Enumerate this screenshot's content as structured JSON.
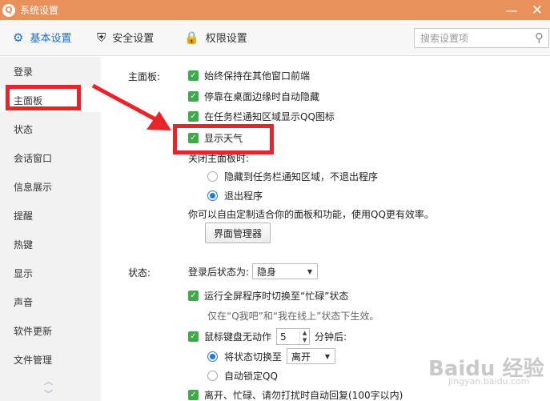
{
  "window": {
    "title": "系统设置",
    "logo_glyph": "Q",
    "minimize_glyph": "—",
    "close_glyph": "✕"
  },
  "tabs": [
    {
      "label": "基本设置",
      "icon": "gear-icon",
      "glyph": "⚙"
    },
    {
      "label": "安全设置",
      "icon": "shield-icon",
      "glyph": "⛨"
    },
    {
      "label": "权限设置",
      "icon": "lock-icon",
      "glyph": "🔒"
    }
  ],
  "search": {
    "placeholder": "搜索设置项",
    "glyph": "⚲"
  },
  "sidebar": {
    "items": [
      "登录",
      "主面板",
      "状态",
      "会话窗口",
      "信息展示",
      "提醒",
      "热键",
      "显示",
      "声音",
      "软件更新",
      "文件管理"
    ],
    "scroll_up": "︿",
    "scroll_down": "﹀"
  },
  "main_panel": {
    "label": "主面板:",
    "options": [
      "始终保持在其他窗口前端",
      "停靠在桌面边缘时自动隐藏",
      "在任务栏通知区域显示QQ图标",
      "显示天气"
    ],
    "close_label": "关闭主面板时:",
    "close_options": [
      "隐藏到任务栏通知区域，不退出程序",
      "退出程序"
    ],
    "tip": "你可以自由定制适合你的面板和功能，使用QQ更有效率。",
    "manager_button": "界面管理器"
  },
  "status": {
    "label": "状态:",
    "after_login_label": "登录后状态为:",
    "after_login_value": "隐身",
    "fullscreen_option": "运行全屏程序时切换至“忙碌”状态",
    "fullscreen_hint": "仅在“Q我吧”和“我在线上”状态下生效。",
    "idle_prefix": "鼠标键盘无动作",
    "idle_minutes": "5",
    "idle_suffix": "分钟后:",
    "switch_label": "将状态切换至",
    "switch_value": "离开",
    "auto_lock": "自动锁定QQ",
    "auto_reply": "离开、忙碌、请勿打扰时自动回复(100字以内)"
  },
  "watermark": {
    "main": "Baidu 经验",
    "sub": "jingyan.baidu.com"
  },
  "colors": {
    "titlebar": "#e8915a",
    "accent": "#1c6fc7",
    "checkbox": "#3dab4a",
    "annotation": "#e8232a"
  }
}
